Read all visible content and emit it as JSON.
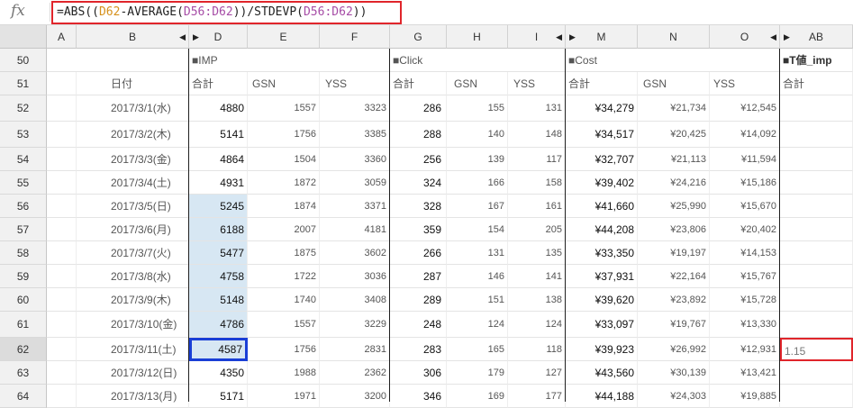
{
  "formula_bar": {
    "fx_icon": "fx",
    "prefix": "=ABS((",
    "ref1": "D62",
    "mid1": "-AVERAGE(",
    "ref2": "D56:D62",
    "mid2": "))/STDEVP(",
    "ref3": "D56:D62",
    "suffix": "))"
  },
  "columns": [
    {
      "id": "corner",
      "label": ""
    },
    {
      "id": "A",
      "label": "A"
    },
    {
      "id": "B",
      "label": "B"
    },
    {
      "id": "D",
      "label": "D"
    },
    {
      "id": "E",
      "label": "E"
    },
    {
      "id": "F",
      "label": "F"
    },
    {
      "id": "G",
      "label": "G"
    },
    {
      "id": "H",
      "label": "H"
    },
    {
      "id": "I",
      "label": "I"
    },
    {
      "id": "M",
      "label": "M"
    },
    {
      "id": "N",
      "label": "N"
    },
    {
      "id": "O",
      "label": "O"
    },
    {
      "id": "AB",
      "label": "AB"
    }
  ],
  "section_labels": {
    "imp": "■IMP",
    "click": "■Click",
    "cost": "■Cost",
    "t": "■T値_imp"
  },
  "subheaders": {
    "date": "日付",
    "total": "合計",
    "gsn": "GSN",
    "yss": "YSS"
  },
  "rows": [
    {
      "n": "52",
      "date": "2017/3/1(水)",
      "d": "4880",
      "e": "1557",
      "f": "3323",
      "g": "286",
      "h": "155",
      "i": "131",
      "m": "¥34,279",
      "nn": "¥21,734",
      "o": "¥12,545",
      "ab": ""
    },
    {
      "n": "53",
      "date": "2017/3/2(木)",
      "d": "5141",
      "e": "1756",
      "f": "3385",
      "g": "288",
      "h": "140",
      "i": "148",
      "m": "¥34,517",
      "nn": "¥20,425",
      "o": "¥14,092",
      "ab": ""
    },
    {
      "n": "54",
      "date": "2017/3/3(金)",
      "d": "4864",
      "e": "1504",
      "f": "3360",
      "g": "256",
      "h": "139",
      "i": "117",
      "m": "¥32,707",
      "nn": "¥21,113",
      "o": "¥11,594",
      "ab": ""
    },
    {
      "n": "55",
      "date": "2017/3/4(土)",
      "d": "4931",
      "e": "1872",
      "f": "3059",
      "g": "324",
      "h": "166",
      "i": "158",
      "m": "¥39,402",
      "nn": "¥24,216",
      "o": "¥15,186",
      "ab": ""
    },
    {
      "n": "56",
      "date": "2017/3/5(日)",
      "d": "5245",
      "e": "1874",
      "f": "3371",
      "g": "328",
      "h": "167",
      "i": "161",
      "m": "¥41,660",
      "nn": "¥25,990",
      "o": "¥15,670",
      "ab": ""
    },
    {
      "n": "57",
      "date": "2017/3/6(月)",
      "d": "6188",
      "e": "2007",
      "f": "4181",
      "g": "359",
      "h": "154",
      "i": "205",
      "m": "¥44,208",
      "nn": "¥23,806",
      "o": "¥20,402",
      "ab": ""
    },
    {
      "n": "58",
      "date": "2017/3/7(火)",
      "d": "5477",
      "e": "1875",
      "f": "3602",
      "g": "266",
      "h": "131",
      "i": "135",
      "m": "¥33,350",
      "nn": "¥19,197",
      "o": "¥14,153",
      "ab": ""
    },
    {
      "n": "59",
      "date": "2017/3/8(水)",
      "d": "4758",
      "e": "1722",
      "f": "3036",
      "g": "287",
      "h": "146",
      "i": "141",
      "m": "¥37,931",
      "nn": "¥22,164",
      "o": "¥15,767",
      "ab": ""
    },
    {
      "n": "60",
      "date": "2017/3/9(木)",
      "d": "5148",
      "e": "1740",
      "f": "3408",
      "g": "289",
      "h": "151",
      "i": "138",
      "m": "¥39,620",
      "nn": "¥23,892",
      "o": "¥15,728",
      "ab": ""
    },
    {
      "n": "61",
      "date": "2017/3/10(金)",
      "d": "4786",
      "e": "1557",
      "f": "3229",
      "g": "248",
      "h": "124",
      "i": "124",
      "m": "¥33,097",
      "nn": "¥19,767",
      "o": "¥13,330",
      "ab": ""
    },
    {
      "n": "62",
      "date": "2017/3/11(土)",
      "d": "4587",
      "e": "1756",
      "f": "2831",
      "g": "283",
      "h": "165",
      "i": "118",
      "m": "¥39,923",
      "nn": "¥26,992",
      "o": "¥12,931",
      "ab": "1.15"
    },
    {
      "n": "63",
      "date": "2017/3/12(日)",
      "d": "4350",
      "e": "1988",
      "f": "2362",
      "g": "306",
      "h": "179",
      "i": "127",
      "m": "¥43,560",
      "nn": "¥30,139",
      "o": "¥13,421",
      "ab": ""
    },
    {
      "n": "64",
      "date": "2017/3/13(月)",
      "d": "5171",
      "e": "1971",
      "f": "3200",
      "g": "346",
      "h": "169",
      "i": "177",
      "m": "¥44,188",
      "nn": "¥24,303",
      "o": "¥19,885",
      "ab": ""
    }
  ],
  "colors": {
    "selection_blue": "#1a3fd6",
    "highlight_red": "#e0252b",
    "range_fill": "#d7e7f3"
  }
}
